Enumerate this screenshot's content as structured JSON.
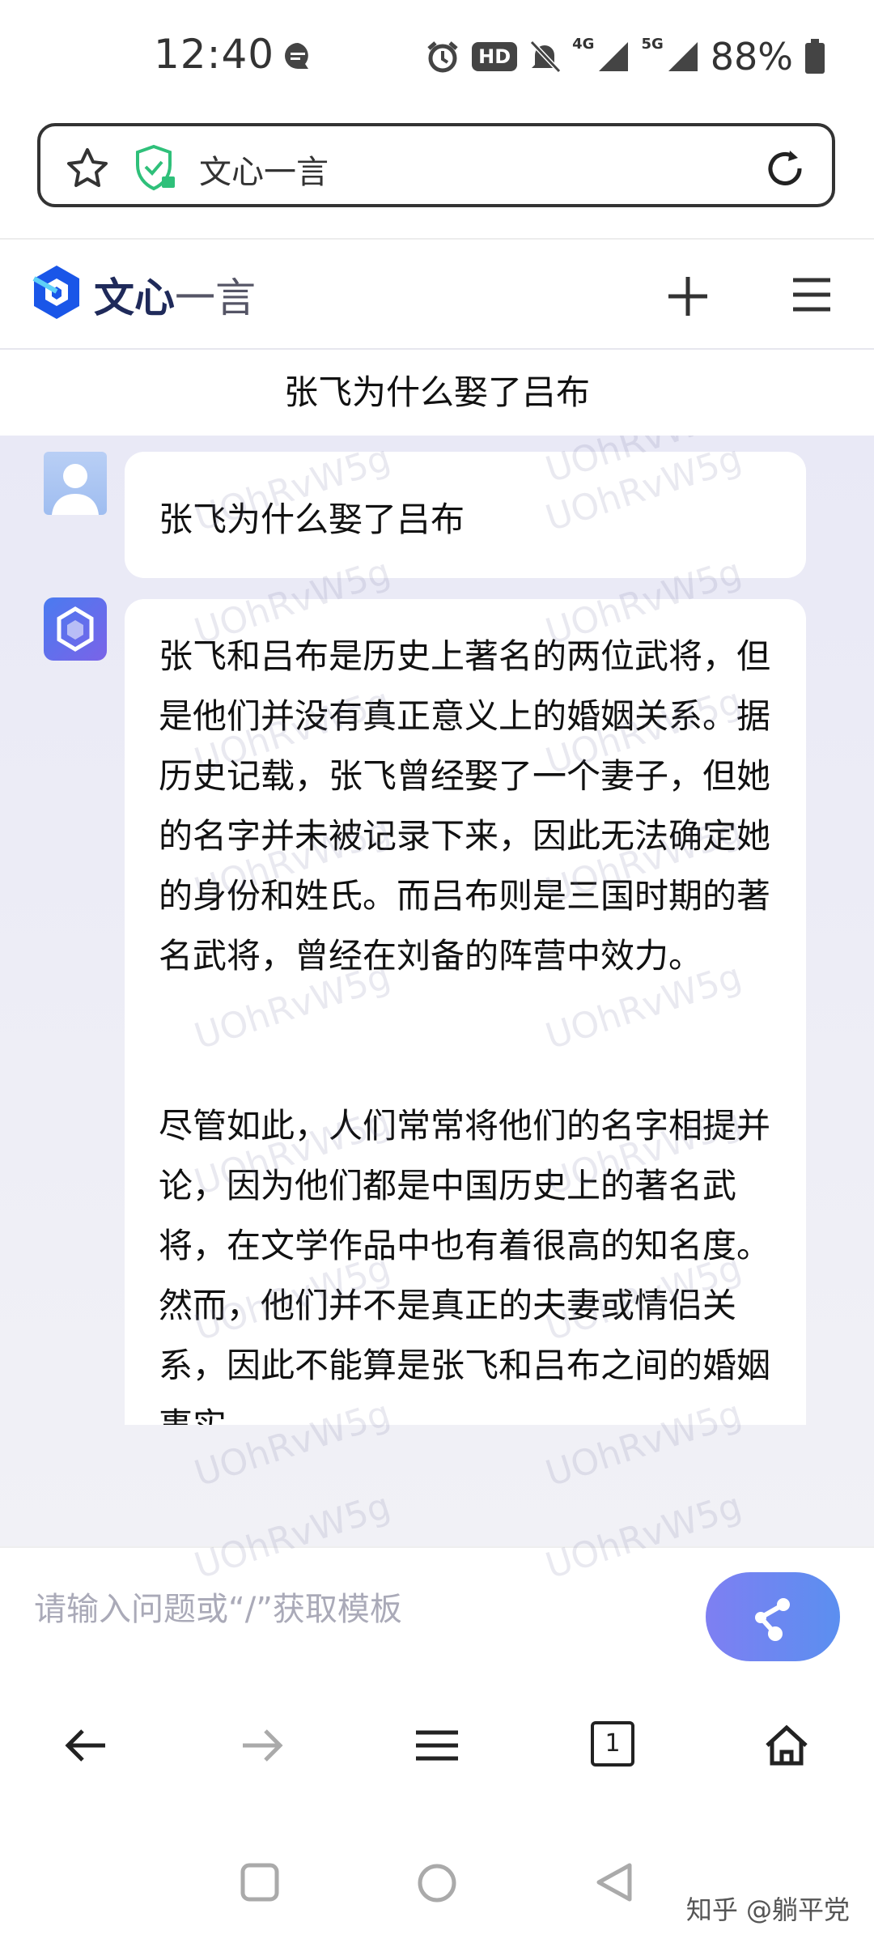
{
  "status_bar": {
    "time": "12:40",
    "hd_label": "HD",
    "network_4g": "4G",
    "network_5g": "5G",
    "battery": "88%"
  },
  "url_bar": {
    "title": "文心一言"
  },
  "app_header": {
    "brand_bold": "文心",
    "brand_light": "一言"
  },
  "conversation": {
    "title": "张飞为什么娶了吕布"
  },
  "messages": {
    "user": {
      "text": "张飞为什么娶了吕布"
    },
    "bot": {
      "para1": "张飞和吕布是历史上著名的两位武将，但是他们并没有真正意义上的婚姻关系。据历史记载，张飞曾经娶了一个妻子，但她的名字并未被记录下来，因此无法确定她的身份和姓氏。而吕布则是三国时期的著名武将，曾经在刘备的阵营中效力。",
      "para2": "尽管如此，人们常常将他们的名字相提并论，因为他们都是中国历史上的著名武将，在文学作品中也有着很高的知名度。然而，他们并不是真正的夫妻或情侣关系，因此不能算是张飞和吕布之间的婚姻事实。"
    }
  },
  "watermark": "UOhRvW5g",
  "input": {
    "placeholder": "请输入问题或“/”获取模板"
  },
  "browser_nav": {
    "tab_count": "1"
  },
  "credit": "知乎 @躺平党",
  "colors": {
    "brand": "#1f2a5a",
    "accent_start": "#7e7ff2",
    "accent_end": "#5b8ff0",
    "shield": "#2fc07a"
  }
}
